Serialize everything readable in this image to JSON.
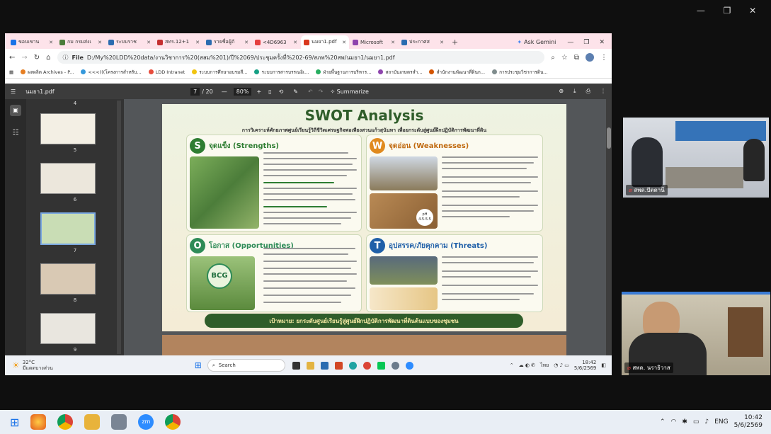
{
  "browser": {
    "tabs": [
      {
        "label": "ขอบเขาน",
        "color": "#1a73e8"
      },
      {
        "label": "กม กรมส่งเ",
        "color": "#4a7c3a"
      },
      {
        "label": "ระบบราช",
        "color": "#2b6cb0"
      },
      {
        "label": "สทร.12+1",
        "color": "#c53030"
      },
      {
        "label": "รายชื่อผู้ถั",
        "color": "#2b6cb0"
      },
      {
        "label": "<4D6963",
        "color": "#e53e3e"
      },
      {
        "label": "นมยา1.pdf",
        "color": "#d9381e",
        "active": true
      },
      {
        "label": "Microsoft",
        "color": "#8e44ad"
      },
      {
        "label": "ประกาศส",
        "color": "#2b6cb0"
      }
    ],
    "new_tab": "+",
    "gemini": "Ask Gemini",
    "file_label": "File",
    "url": "D:/My%20LDD%20data/งานวิชาการ%20(สสม%201)/ปี%2069/ประชุมครั้งที่%202-69/สภพ%20สพ/นมยา1/นมยา1.pdf",
    "bookmarks": [
      "ผลผลิต Archives - P...",
      "<<<(((โครงการสำหรับ...",
      "LDD Intranet",
      "ระบบการศึกษาอบรมสี...",
      "ระบบการสารบรรณอิเ...",
      "ฝ่ายพื้นฐานการบริหาร...",
      "สถาบันเกษตรสำ...",
      "สำนักงานพัฒนาที่ดินก...",
      "การประชุมวิชาการดิน..."
    ]
  },
  "pdf": {
    "filename": "นมยา1.pdf",
    "page_current": "7",
    "page_total": "/ 20",
    "zoom": "80%",
    "summarize": "Summarize",
    "thumb_numbers": [
      "4",
      "5",
      "6",
      "7",
      "8",
      "9"
    ]
  },
  "swot": {
    "title": "SWOT Analysis",
    "subtitle": "การวิเคราะห์ศักยภาพศูนย์เรียนรู้วิถีชีวิตเศรษฐกิจพอเพียงสวนแก้วสุนันทา เพื่อยกระดับสู่ศูนย์ฝึกปฏิบัติการพัฒนาที่ดิน",
    "strengths_letter": "S",
    "strengths": "จุดแข็ง (Strengths)",
    "weaknesses_letter": "W",
    "weaknesses": "จุดอ่อน (Weaknesses)",
    "opportunities_letter": "O",
    "opportunities": "โอกาส (Opportunities)",
    "threats_letter": "T",
    "threats": "อุปสรรค/ภัยคุกคาม (Threats)",
    "bcg": "BCG",
    "ph_label": "pH",
    "ph_range": "4.5-5.5",
    "goal": "เป้าหมาย: ยกระดับศูนย์เรียนรู้สู่ศูนย์ฝึกปฏิบัติการพัฒนาที่ดินต้นแบบของชุมชน",
    "colors": {
      "s": "#2e7d32",
      "w": "#e08a1e",
      "o": "#2e8b57",
      "t": "#1f5fa8"
    }
  },
  "taskbar_inner": {
    "temp": "32°C",
    "weather": "มีแดดบางส่วน",
    "search": "Search",
    "lang": "ไทย",
    "time": "18:42",
    "date": "5/6/2569"
  },
  "participants": [
    {
      "name": "สพด.ปัตตานี"
    },
    {
      "name": "สพด. นราธิวาส"
    }
  ],
  "windows_taskbar": {
    "lang": "ENG",
    "time": "10:42",
    "date": "5/6/2569"
  }
}
